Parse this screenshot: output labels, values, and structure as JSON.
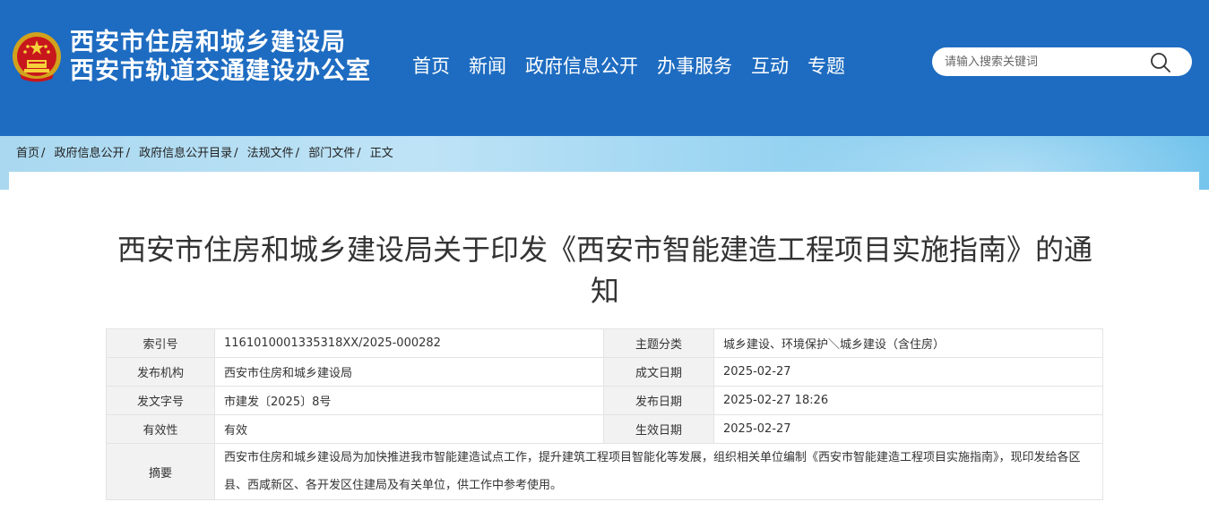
{
  "header": {
    "site_name_line1": "西安市住房和城乡建设局",
    "site_name_line2": "西安市轨道交通建设办公室",
    "nav": [
      "首页",
      "新闻",
      "政府信息公开",
      "办事服务",
      "互动",
      "专题"
    ],
    "search_placeholder": "请输入搜索关键词",
    "colors": {
      "header_bg": "#1e6cc1",
      "text": "#ffffff"
    }
  },
  "breadcrumb": [
    "首页",
    "政府信息公开",
    "政府信息公开目录",
    "法规文件",
    "部门文件",
    "正文"
  ],
  "breadcrumb_separator": "/",
  "document": {
    "title": "西安市住房和城乡建设局关于印发《西安市智能建造工程项目实施指南》的通知",
    "meta": {
      "index_no_label": "索引号",
      "index_no": "1161010001335318XX/2025-000282",
      "topic_label": "主题分类",
      "topic": "城乡建设、环境保护＼城乡建设（含住房）",
      "publisher_label": "发布机构",
      "publisher": "西安市住房和城乡建设局",
      "created_label": "成文日期",
      "created": "2025-02-27",
      "doc_no_label": "发文字号",
      "doc_no": "市建发〔2025〕8号",
      "published_label": "发布日期",
      "published": "2025-02-27 18:26",
      "validity_label": "有效性",
      "validity": "有效",
      "effective_label": "生效日期",
      "effective": "2025-02-27",
      "abstract_label": "摘要",
      "abstract": "西安市住房和城乡建设局为加快推进我市智能建造试点工作，提升建筑工程项目智能化等发展，组织相关单位编制《西安市智能建造工程项目实施指南》，现印发给各区县、西咸新区、各开发区住建局及有关单位，供工作中参考使用。"
    }
  }
}
